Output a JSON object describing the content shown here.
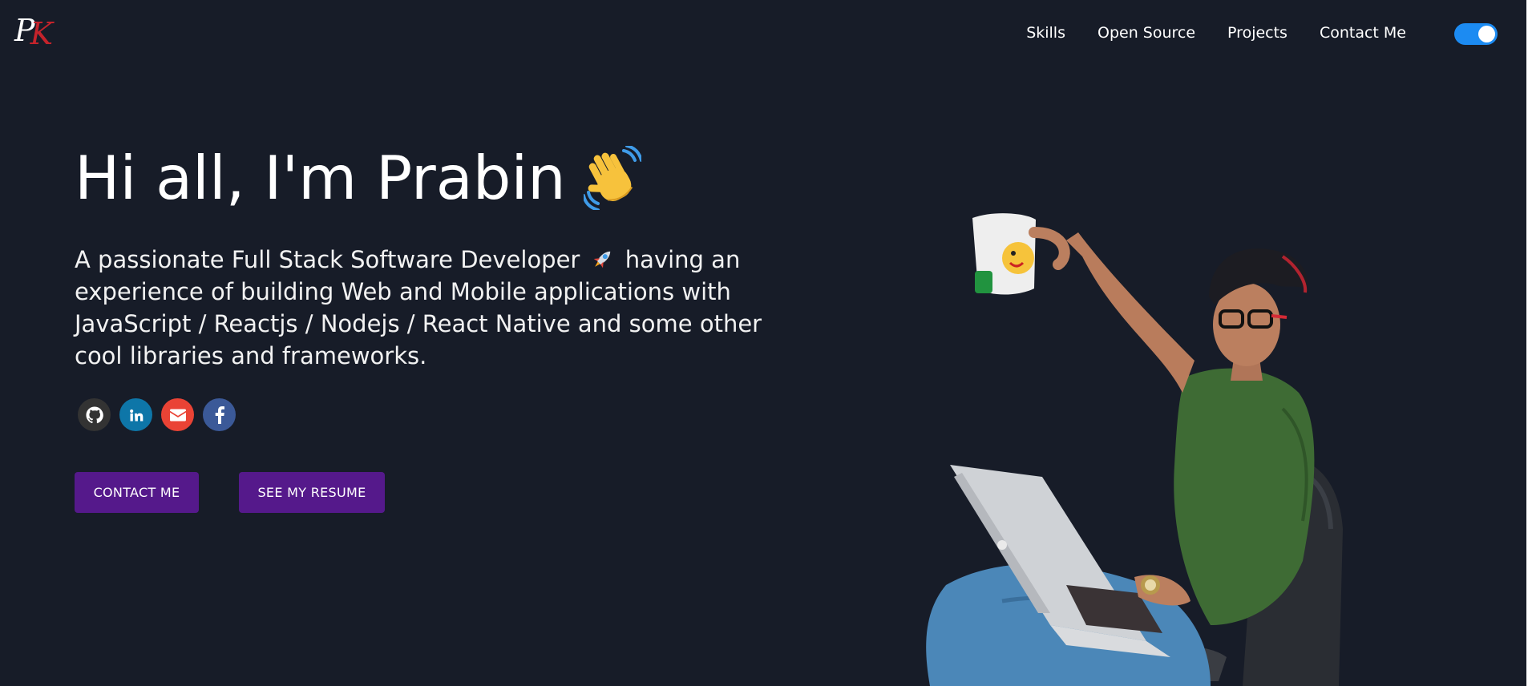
{
  "header": {
    "logo": {
      "first": "P",
      "second": "K"
    },
    "nav": [
      {
        "label": "Skills"
      },
      {
        "label": "Open Source"
      },
      {
        "label": "Projects"
      },
      {
        "label": "Contact Me"
      }
    ],
    "theme_toggle": {
      "state": "on",
      "color": "#1c8bf2"
    }
  },
  "hero": {
    "greeting": "Hi all, I'm Prabin",
    "greeting_icon": "waving-hand-icon",
    "intro_part1": "A passionate Full Stack Software Developer",
    "intro_icon": "rocket-icon",
    "intro_part2": "having an experience of building Web and Mobile applications with JavaScript / Reactjs / Nodejs / React Native and some other cool libraries and frameworks."
  },
  "socials": [
    {
      "icon": "github-icon",
      "color": "#333333"
    },
    {
      "icon": "linkedin-icon",
      "color": "#0e76a8"
    },
    {
      "icon": "mail-icon",
      "color": "#ea4335"
    },
    {
      "icon": "facebook-icon",
      "color": "#3b5998"
    }
  ],
  "buttons": {
    "contact": "CONTACT ME",
    "resume": "SEE MY RESUME",
    "color": "#55198b"
  },
  "theme": {
    "background": "#171c28",
    "text": "#ffffff"
  }
}
